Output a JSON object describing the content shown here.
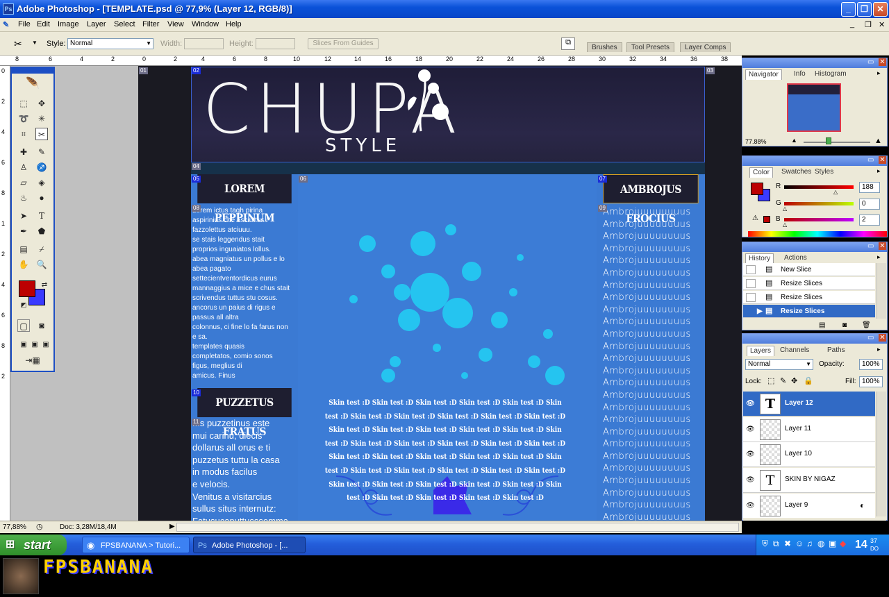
{
  "window": {
    "title": "Adobe Photoshop - [TEMPLATE.psd @ 77,9% (Layer 12, RGB/8)]",
    "minimize": "_",
    "restore": "❐",
    "close": "✕"
  },
  "menu": [
    "File",
    "Edit",
    "Image",
    "Layer",
    "Select",
    "Filter",
    "View",
    "Window",
    "Help"
  ],
  "options": {
    "style_label": "Style:",
    "style_value": "Normal",
    "width_label": "Width:",
    "height_label": "Height:",
    "slices_button": "Slices From Guides",
    "palette_tabs": [
      "Brushes",
      "Tool Presets",
      "Layer Comps"
    ]
  },
  "rulers": {
    "h": [
      "8",
      "6",
      "4",
      "2",
      "0",
      "2",
      "4",
      "6",
      "8",
      "10",
      "12",
      "14",
      "16",
      "18",
      "20",
      "22",
      "24",
      "26",
      "28",
      "30",
      "32",
      "34",
      "36",
      "38"
    ],
    "v": [
      "0",
      "2",
      "4",
      "6",
      "8",
      "1",
      "2",
      "4",
      "6",
      "8",
      "2"
    ]
  },
  "canvas": {
    "logo_main": "CHUPA",
    "logo_sub": "STYLE",
    "slice_tags": [
      "01",
      "02",
      "03",
      "04",
      "05",
      "06",
      "07",
      "08",
      "09",
      "10",
      "11"
    ],
    "left_box1_title": "LOREM PEPPINUM",
    "left_box1_text": [
      "Lorem ictus tagh pirina",
      "aspirinius che asciuttus i",
      "fazzolettus atciuuu.",
      "se stais leggendus stait",
      "proprios inguaiatos lollus.",
      "abea magniatus un pollus e lo",
      "abea pagato",
      "settecientventordicus eurus",
      "mannaggius a mice e chus stait",
      "scrivendus tuttus stu cosus.",
      "ancorus un paius di rigus e",
      "passus all altra",
      "colonnus, ci fine lo fa farus non",
      "e sa.",
      "templates quasis",
      "completatos, comio sonos",
      "figus, meglius di",
      "amicus. Finus"
    ],
    "left_box2_title": "PUZZETUS FRATUS",
    "left_box2_text": [
      "...s puzzetinus este",
      "mui carinu, diecis",
      "dollarus all orus e ti",
      "puzzetus tuttu la casa",
      "in modus facilus",
      "e velocis.",
      "Venitus a visitarcius",
      "sullus situs internutz:",
      "Fatusucaputtusssomma"
    ],
    "skin_text": "Skin test :D Skin test :D Skin test :D Skin test :D Skin test :D Skin test :D Skin test :D Skin test :D Skin test :D Skin test :D Skin test :D Skin test :D Skin test :D Skin test :D Skin test :D Skin test :D Skin test :D Skin test :D Skin test :D Skin test :D Skin test :D Skin test :D Skin test :D Skin test :D Skin test :D Skin test :D Skin test :D Skin test :D Skin test :D Skin test :D Skin test :D Skin test :D Skin test :D Skin test :D Skin test :D Skin test :D Skin test :D Skin test :D Skin test :D Skin test :D Skin test :D Skin test :D Skin test :D",
    "right_box_title": "AMBROJUS FROCIUS",
    "right_line": "Ambrojuuuuuuuus"
  },
  "navigator": {
    "tabs": [
      "Navigator",
      "Info",
      "Histogram"
    ],
    "zoom": "77.88%"
  },
  "color": {
    "tabs": [
      "Color",
      "Swatches",
      "Styles"
    ],
    "r_label": "R",
    "g_label": "G",
    "b_label": "B",
    "r": "188",
    "g": "0",
    "b": "2",
    "fg": "#bc0002",
    "bg": "#3a3aff"
  },
  "history": {
    "tabs": [
      "History",
      "Actions"
    ],
    "items": [
      "New Slice",
      "Resize Slices",
      "Resize Slices",
      "Resize Slices"
    ]
  },
  "layers": {
    "tabs": [
      "Layers",
      "Channels",
      "Paths"
    ],
    "blend": "Normal",
    "opacity_label": "Opacity:",
    "opacity": "100%",
    "lock_label": "Lock:",
    "fill_label": "Fill:",
    "fill": "100%",
    "items": [
      {
        "name": "Layer 12",
        "type": "text"
      },
      {
        "name": "Layer 11",
        "type": "raster"
      },
      {
        "name": "Layer 10",
        "type": "raster"
      },
      {
        "name": "SKIN BY NIGAZ",
        "type": "text"
      },
      {
        "name": "Layer 9",
        "type": "raster"
      }
    ]
  },
  "status": {
    "zoom": "77,88%",
    "doc": "Doc: 3,28M/18,4M"
  },
  "taskbar": {
    "start": "start",
    "tasks": [
      "FPSBANANA > Tutori...",
      "Adobe Photoshop - [..."
    ],
    "time_h": "14",
    "time_m": "37",
    "time_s": "DO"
  },
  "banner": {
    "logo": "FPSBANANA"
  }
}
